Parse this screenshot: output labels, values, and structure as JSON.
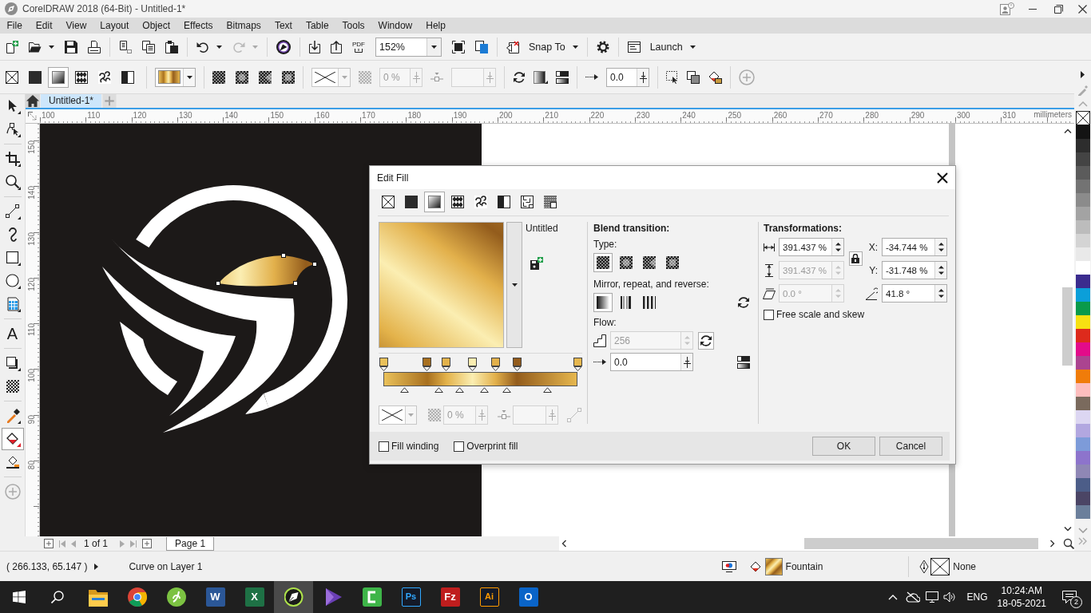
{
  "window": {
    "title": "CorelDRAW 2018 (64-Bit) - Untitled-1*"
  },
  "menu": [
    "File",
    "Edit",
    "View",
    "Layout",
    "Object",
    "Effects",
    "Bitmaps",
    "Text",
    "Table",
    "Tools",
    "Window",
    "Help"
  ],
  "standard_toolbar": {
    "pdf": "PDF",
    "zoom": "152%",
    "snap_to": "Snap To",
    "launch": "Launch"
  },
  "property_bar": {
    "fill_types": [
      {
        "kind": "none",
        "selected": false
      },
      {
        "kind": "uniform",
        "selected": false
      },
      {
        "kind": "fountain",
        "selected": true
      },
      {
        "kind": "vector",
        "selected": false
      },
      {
        "kind": "bitmap",
        "selected": false
      },
      {
        "kind": "two_color",
        "selected": false
      }
    ],
    "transparency": {
      "value": "0 %",
      "disabled": true
    },
    "acceleration": {
      "value": "0.0",
      "disabled": false
    }
  },
  "toolbox": [
    {
      "tools": [
        {
          "kind": "pick",
          "selected": false
        },
        {
          "kind": "shape",
          "selected": false
        }
      ]
    },
    {
      "tools": [
        {
          "kind": "crop",
          "selected": false
        },
        {
          "kind": "zoom",
          "selected": false
        }
      ]
    },
    {
      "tools": [
        {
          "kind": "line",
          "selected": false
        },
        {
          "kind": "artistic",
          "selected": false
        },
        {
          "kind": "rectangle",
          "selected": false
        },
        {
          "kind": "ellipse",
          "selected": false
        },
        {
          "kind": "table",
          "selected": false
        }
      ]
    },
    {
      "tools": [
        {
          "kind": "text",
          "glyph": "A",
          "selected": false
        }
      ]
    },
    {
      "tools": [
        {
          "kind": "shadow",
          "selected": false
        },
        {
          "kind": "transparency",
          "selected": false
        }
      ]
    },
    {
      "tools": [
        {
          "kind": "eyedropper",
          "selected": false
        },
        {
          "kind": "interactive_fill",
          "selected": true
        },
        {
          "kind": "smart_fill",
          "selected": false
        }
      ]
    },
    {
      "tools": [
        {
          "kind": "add",
          "selected": false
        }
      ]
    }
  ],
  "document_tabs": [
    {
      "label": "Untitled-1*",
      "selected": true
    }
  ],
  "rulers": {
    "horizontal": [
      "100",
      "110",
      "120",
      "130",
      "140",
      "150",
      "160",
      "170",
      "180",
      "190",
      "200",
      "210",
      "220",
      "230",
      "240",
      "250",
      "260",
      "270",
      "280",
      "290",
      "300",
      "310"
    ],
    "unit": "millimeters",
    "vertical": [
      "150",
      "140",
      "130",
      "120",
      "110",
      "100",
      "90",
      "80"
    ]
  },
  "page_nav": {
    "counter": "1 of 1",
    "pages": [
      {
        "label": "Page 1",
        "selected": true
      }
    ]
  },
  "palette": [
    {
      "kind": "none"
    },
    {
      "kind": "swatch",
      "color": "#141414"
    },
    {
      "kind": "swatch",
      "color": "#2d2d2d"
    },
    {
      "kind": "swatch",
      "color": "#444444"
    },
    {
      "kind": "swatch",
      "color": "#5b5b5b"
    },
    {
      "kind": "swatch",
      "color": "#737373"
    },
    {
      "kind": "swatch",
      "color": "#8b8b8b"
    },
    {
      "kind": "swatch",
      "color": "#a3a3a3"
    },
    {
      "kind": "swatch",
      "color": "#bcbcbc"
    },
    {
      "kind": "swatch",
      "color": "#d4d4d4"
    },
    {
      "kind": "swatch",
      "color": "#e9e9e9"
    },
    {
      "kind": "swatch",
      "color": "#ffffff"
    },
    {
      "kind": "swatch",
      "color": "#3b2c8e"
    },
    {
      "kind": "swatch",
      "color": "#0b9fd9"
    },
    {
      "kind": "swatch",
      "color": "#0a9a4b"
    },
    {
      "kind": "swatch",
      "color": "#f7e112"
    },
    {
      "kind": "swatch",
      "color": "#dd2a1c"
    },
    {
      "kind": "swatch",
      "color": "#e30b8a"
    },
    {
      "kind": "swatch",
      "color": "#ab4490"
    },
    {
      "kind": "swatch",
      "color": "#f07c0a"
    },
    {
      "kind": "swatch",
      "color": "#fdbdbd"
    },
    {
      "kind": "swatch",
      "color": "#7a6a5d"
    },
    {
      "kind": "swatch",
      "color": "#dcd6f2"
    },
    {
      "kind": "swatch",
      "color": "#b2a7e0"
    },
    {
      "kind": "swatch",
      "color": "#7d9bd9"
    },
    {
      "kind": "swatch",
      "color": "#8d74cc"
    },
    {
      "kind": "swatch",
      "color": "#8f87b5"
    },
    {
      "kind": "swatch",
      "color": "#4c5d88"
    },
    {
      "kind": "swatch",
      "color": "#4b4565"
    },
    {
      "kind": "swatch",
      "color": "#6b7f9b"
    }
  ],
  "edit_fill": {
    "title": "Edit Fill",
    "fill_types": [
      {
        "kind": "none",
        "selected": false
      },
      {
        "kind": "uniform",
        "selected": false
      },
      {
        "kind": "fountain",
        "selected": true
      },
      {
        "kind": "vector",
        "selected": false
      },
      {
        "kind": "bitmap",
        "selected": false
      },
      {
        "kind": "two_color",
        "selected": false
      },
      {
        "kind": "texture",
        "selected": false
      },
      {
        "kind": "postscript",
        "selected": false
      }
    ],
    "preset": "Untitled",
    "stops": [
      {
        "color": "#eac15a",
        "level": 0
      },
      {
        "color": "#a8701f",
        "level": 0.225
      },
      {
        "color": "#e3b24a",
        "level": 0.324
      },
      {
        "color": "#fbeeb2",
        "level": 0.459
      },
      {
        "color": "#e2b04b",
        "level": 0.578
      },
      {
        "color": "#935c1c",
        "level": 0.689
      },
      {
        "color": "#e6b74e",
        "level": 1
      }
    ],
    "midpoints": [
      {
        "level": 0.11
      },
      {
        "level": 0.285
      },
      {
        "level": 0.395
      },
      {
        "level": 0.52
      },
      {
        "level": 0.635
      },
      {
        "level": 0.845
      }
    ],
    "transparency": {
      "value": "0 %",
      "disabled": true
    },
    "blend": {
      "heading": "Blend transition:",
      "type_label": "Type:",
      "types": [
        {
          "kind": "linear",
          "selected": true
        },
        {
          "kind": "elliptical",
          "selected": false
        },
        {
          "kind": "conical",
          "selected": false
        },
        {
          "kind": "rectangular",
          "selected": false
        }
      ],
      "mirror_label": "Mirror, repeat, and reverse:",
      "modes": [
        {
          "kind": "default",
          "selected": true
        },
        {
          "kind": "mirror",
          "selected": false
        },
        {
          "kind": "repeat",
          "selected": false
        }
      ],
      "flow_label": "Flow:",
      "steps": {
        "value": "256",
        "disabled": true
      },
      "acceleration": {
        "value": "0.0",
        "disabled": false
      }
    },
    "transform": {
      "heading": "Transformations:",
      "size": [
        {
          "kind": "width",
          "value": "391.437 %",
          "disabled": false
        },
        {
          "kind": "height",
          "value": "391.437 %",
          "disabled": true
        },
        {
          "kind": "skew",
          "value": "0.0 °",
          "disabled": true
        }
      ],
      "position": [
        {
          "kind": "x",
          "label": "X:",
          "value": "-34.744 %"
        },
        {
          "kind": "y",
          "label": "Y:",
          "value": "-31.748 %"
        },
        {
          "kind": "rotation",
          "value": "41.8 °"
        }
      ],
      "free_scale": {
        "label": "Free scale and skew",
        "checked": false
      }
    },
    "options": [
      {
        "label": "Fill winding",
        "checked": false
      },
      {
        "label": "Overprint fill",
        "checked": false
      }
    ],
    "buttons": [
      "OK",
      "Cancel"
    ]
  },
  "status_bar": {
    "coordinates": "( 266.133, 65.147 )",
    "selection": "Curve on Layer 1",
    "fill": "Fountain",
    "outline": "None"
  },
  "taskbar": {
    "apps": [
      {
        "kind": "folder",
        "active": false
      },
      {
        "kind": "wheel",
        "active": false
      },
      {
        "kind": "swirl",
        "active": false
      },
      {
        "kind": "tile",
        "glyph": "W",
        "color": "#2b5797",
        "active": false
      },
      {
        "kind": "tile",
        "glyph": "X",
        "color": "#1e7145",
        "active": false
      },
      {
        "kind": "nib",
        "active": true
      },
      {
        "kind": "play",
        "active": false
      },
      {
        "kind": "bracket",
        "active": false
      },
      {
        "kind": "outlined",
        "glyph": "Ps",
        "color": "#31a8ff",
        "active": false
      },
      {
        "kind": "tile",
        "glyph": "Fz",
        "color": "#bf1e1e",
        "active": false
      },
      {
        "kind": "outlined",
        "glyph": "Ai",
        "color": "#ff9a00",
        "active": false
      },
      {
        "kind": "tile",
        "glyph": "O",
        "color": "#0a64c8",
        "active": false
      }
    ],
    "language": "ENG",
    "time": "10:24:AM",
    "date": "18-05-2021",
    "notifications": "2"
  }
}
